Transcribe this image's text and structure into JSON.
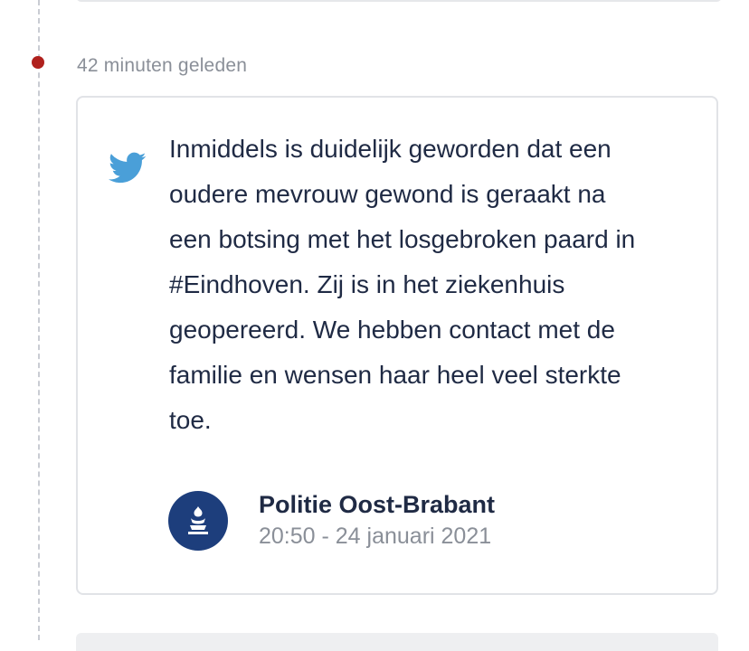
{
  "timeline": {
    "dot_color": "#b0211d",
    "timestamp": "42 minuten geleden"
  },
  "tweet": {
    "icon": "twitter-bird-icon",
    "icon_color": "#4a9fd8",
    "text": "Inmiddels is duidelijk geworden dat een\noudere mevrouw gewond is geraakt na\neen botsing met het losgebroken paard in\n#Eindhoven. Zij is in het ziekenhuis\ngeopereerd. We hebben contact met de\nfamilie en wensen haar heel veel sterkte\ntoe.",
    "author": {
      "avatar_icon": "police-logo-icon",
      "avatar_color": "#1d3e7c",
      "name": "Politie Oost-Brabant",
      "datetime": "20:50 - 24 januari 2021"
    }
  }
}
